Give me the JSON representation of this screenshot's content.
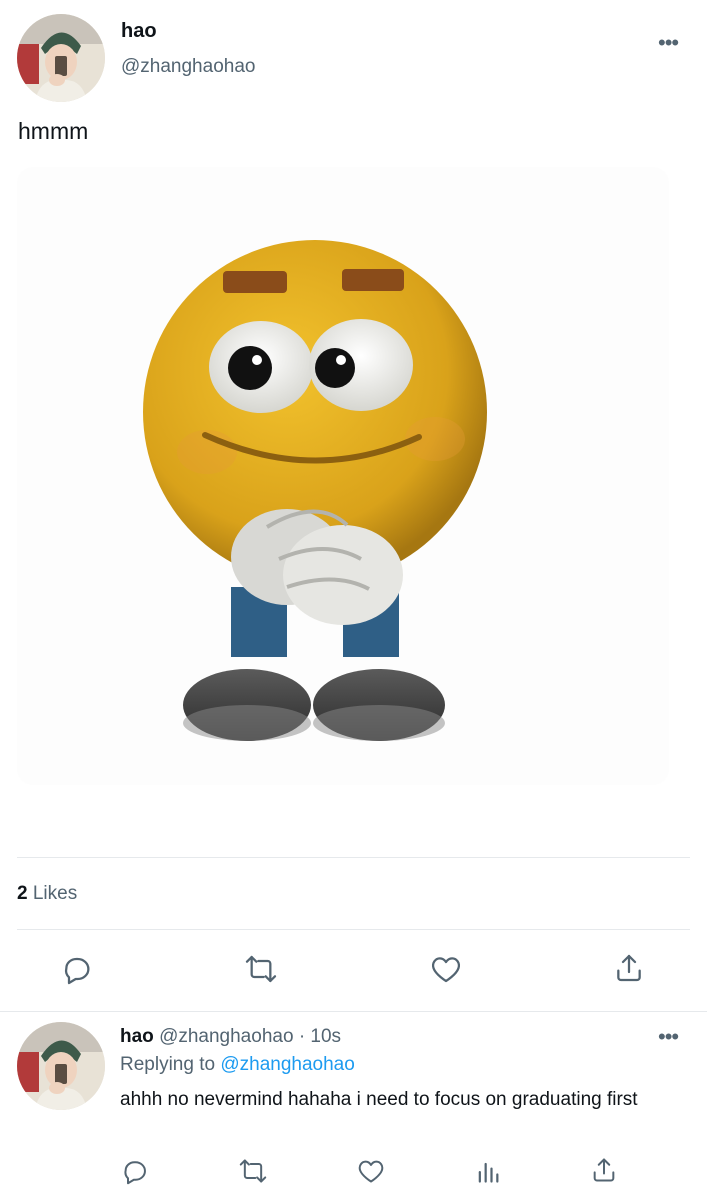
{
  "tweet": {
    "author_name": "hao",
    "author_handle": "@zhanghaohao",
    "text": "hmmm",
    "likes_count": "2",
    "likes_label": "Likes"
  },
  "reply": {
    "author_name": "hao",
    "author_handle": "@zhanghaohao",
    "separator": "·",
    "time": "10s",
    "replying_label": "Replying to",
    "replying_handle": "@zhanghaohao",
    "text": "ahhh no nevermind hahaha i need to focus on graduating first"
  },
  "icons": {
    "more": "more-options-icon",
    "reply": "reply-icon",
    "retweet": "retweet-icon",
    "like": "heart-icon",
    "share": "share-icon",
    "analytics": "analytics-icon"
  },
  "colors": {
    "text": "#0f1419",
    "secondary": "#536471",
    "link": "#1d9bf0",
    "divider": "#e6e9ec"
  }
}
